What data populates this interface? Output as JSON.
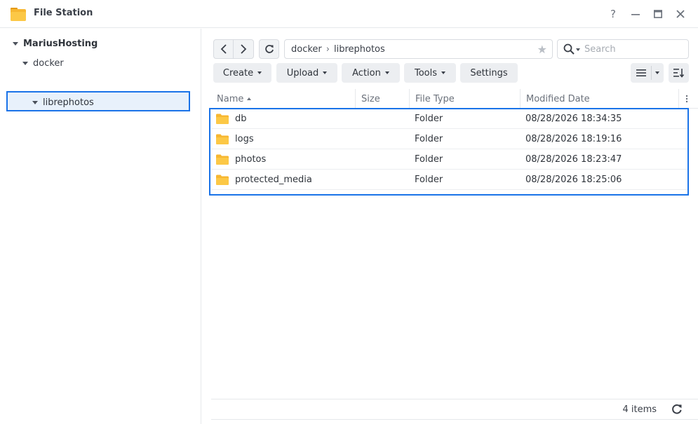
{
  "window": {
    "title": "File Station",
    "help_label": "?"
  },
  "sidebar": {
    "root": "MariusHosting",
    "items": [
      {
        "label": "docker"
      },
      {
        "label": "librephotos"
      }
    ]
  },
  "toolbar": {
    "path": [
      "docker",
      "librephotos"
    ],
    "search_placeholder": "Search",
    "buttons": {
      "create": "Create",
      "upload": "Upload",
      "action": "Action",
      "tools": "Tools",
      "settings": "Settings"
    }
  },
  "table": {
    "columns": [
      "Name",
      "Size",
      "File Type",
      "Modified Date"
    ],
    "rows": [
      {
        "name": "db",
        "size": "",
        "type": "Folder",
        "modified": "08/28/2026 18:34:35"
      },
      {
        "name": "logs",
        "size": "",
        "type": "Folder",
        "modified": "08/28/2026 18:19:16"
      },
      {
        "name": "photos",
        "size": "",
        "type": "Folder",
        "modified": "08/28/2026 18:23:47"
      },
      {
        "name": "protected_media",
        "size": "",
        "type": "Folder",
        "modified": "08/28/2026 18:25:06"
      }
    ]
  },
  "footer": {
    "item_count": "4 items"
  },
  "colors": {
    "accent": "#1a73e8",
    "folder": "#f7b731",
    "folder_dark": "#e59a12"
  }
}
